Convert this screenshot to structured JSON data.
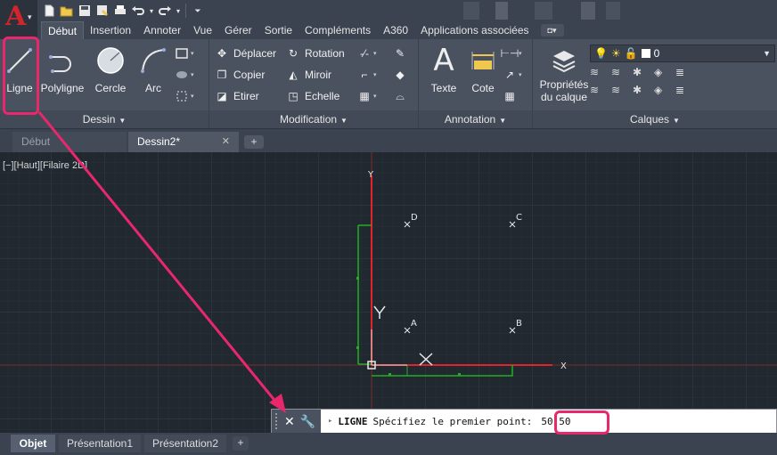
{
  "quick_access": {
    "icons": [
      "new-icon",
      "open-icon",
      "save-icon",
      "saveas-icon",
      "print-icon",
      "undo-icon",
      "redo-icon",
      "customize-icon"
    ]
  },
  "ribbon_tabs": [
    "Début",
    "Insertion",
    "Annoter",
    "Vue",
    "Gérer",
    "Sortie",
    "Compléments",
    "A360",
    "Applications associées"
  ],
  "active_tab_index": 0,
  "panels": {
    "dessin": {
      "title": "Dessin",
      "ligne": "Ligne",
      "polyligne": "Polyligne",
      "cercle": "Cercle",
      "arc": "Arc"
    },
    "modification": {
      "title": "Modification",
      "deplacer": "Déplacer",
      "rotation": "Rotation",
      "copier": "Copier",
      "miroir": "Miroir",
      "etirer": "Etirer",
      "echelle": "Echelle"
    },
    "annotation": {
      "title": "Annotation",
      "texte": "Texte",
      "cote": "Cote"
    },
    "calques": {
      "title": "Calques",
      "proprietes_line1": "Propriétés",
      "proprietes_line2": "du calque",
      "current_layer": "0"
    }
  },
  "file_tabs": {
    "debut": "Début",
    "dessin2": "Dessin2*",
    "close_glyph": "✕",
    "add_glyph": "+"
  },
  "viewport_label": "[−][Haut][Filaire 2D]",
  "drawing": {
    "axis_x_label": "X",
    "axis_y_label": "Y",
    "points": [
      "A",
      "B",
      "C",
      "D"
    ]
  },
  "command_line": {
    "command": "LIGNE",
    "prompt": "Spécifiez le premier point:",
    "input_value": "50,50"
  },
  "layout_tabs": [
    "Objet",
    "Présentation1",
    "Présentation2"
  ],
  "layout_add": "+",
  "colors": {
    "highlight": "#e8276c",
    "grid": "#2e3743",
    "axis_red": "#e0242a",
    "axis_green": "#21b021"
  }
}
